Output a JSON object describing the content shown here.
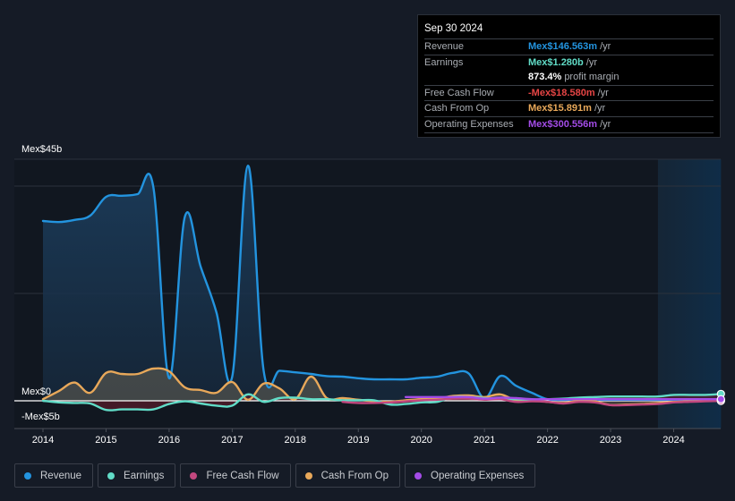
{
  "tooltip": {
    "date": "Sep 30 2024",
    "rows": [
      {
        "label": "Revenue",
        "value": "Mex$146.563m",
        "unit": "/yr",
        "color": "#2394df"
      },
      {
        "label": "Earnings",
        "value": "Mex$1.280b",
        "unit": "/yr",
        "color": "#61dcc7"
      },
      {
        "label": "",
        "value": "873.4%",
        "unit": "profit margin",
        "color": "#ffffff"
      },
      {
        "label": "Free Cash Flow",
        "value": "-Mex$18.580m",
        "unit": "/yr",
        "color": "#e64545"
      },
      {
        "label": "Cash From Op",
        "value": "Mex$15.891m",
        "unit": "/yr",
        "color": "#e8a85a"
      },
      {
        "label": "Operating Expenses",
        "value": "Mex$300.556m",
        "unit": "/yr",
        "color": "#a44ce8"
      }
    ]
  },
  "legend": [
    {
      "label": "Revenue",
      "color": "#2394df"
    },
    {
      "label": "Earnings",
      "color": "#61dcc7"
    },
    {
      "label": "Free Cash Flow",
      "color": "#c2487f"
    },
    {
      "label": "Cash From Op",
      "color": "#e8a85a"
    },
    {
      "label": "Operating Expenses",
      "color": "#a44ce8"
    }
  ],
  "chart_data": {
    "type": "line",
    "title": "",
    "xlabel": "",
    "ylabel": "",
    "y_unit": "Mex$ billions",
    "ylim": [
      -5,
      45
    ],
    "xlim": [
      2013.55,
      2024.75
    ],
    "y_tick_labels": [
      {
        "value": 45,
        "label": "Mex$45b"
      },
      {
        "value": 0,
        "label": "Mex$0"
      },
      {
        "value": -5,
        "label": "-Mex$5b"
      }
    ],
    "gridlines": [
      45,
      40,
      20
    ],
    "x_ticks": [
      2014,
      2015,
      2016,
      2017,
      2018,
      2019,
      2020,
      2021,
      2022,
      2023,
      2024
    ],
    "x_tick_labels": [
      "2014",
      "2015",
      "2016",
      "2017",
      "2018",
      "2019",
      "2020",
      "2021",
      "2022",
      "2023",
      "2024"
    ],
    "highlight_region": [
      2023.75,
      2024.75
    ],
    "series": [
      {
        "name": "Revenue",
        "color": "#2394df",
        "area": true,
        "x": [
          2014.0,
          2014.25,
          2014.5,
          2014.75,
          2015.0,
          2015.25,
          2015.5,
          2015.75,
          2016.0,
          2016.25,
          2016.5,
          2016.75,
          2017.0,
          2017.25,
          2017.5,
          2017.75,
          2018.0,
          2018.25,
          2018.5,
          2018.75,
          2019.0,
          2019.25,
          2019.5,
          2019.75,
          2020.0,
          2020.25,
          2020.5,
          2020.75,
          2021.0,
          2021.25,
          2021.5,
          2021.75,
          2022.0,
          2022.25,
          2022.5,
          2022.75,
          2023.0,
          2023.25,
          2023.5,
          2023.75,
          2024.0,
          2024.25,
          2024.5,
          2024.75
        ],
        "values": [
          33.5,
          33.3,
          33.7,
          34.5,
          38.0,
          38.2,
          38.5,
          39.8,
          4.2,
          34.3,
          25.0,
          16.5,
          4.5,
          43.8,
          5.5,
          5.6,
          5.3,
          5.0,
          4.6,
          4.5,
          4.2,
          4.0,
          4.0,
          4.0,
          4.3,
          4.5,
          5.2,
          5.1,
          0.5,
          4.6,
          2.8,
          1.5,
          0.3,
          0.2,
          0.2,
          0.2,
          0.2,
          0.2,
          0.2,
          0.2,
          0.2,
          0.15,
          0.15,
          0.15
        ]
      },
      {
        "name": "Earnings",
        "color": "#61dcc7",
        "area": true,
        "x": [
          2014.0,
          2014.25,
          2014.5,
          2014.75,
          2015.0,
          2015.25,
          2015.5,
          2015.75,
          2016.0,
          2016.25,
          2016.5,
          2016.75,
          2017.0,
          2017.25,
          2017.5,
          2017.75,
          2018.0,
          2018.25,
          2018.5,
          2018.75,
          2019.0,
          2019.25,
          2019.5,
          2019.75,
          2020.0,
          2020.25,
          2020.5,
          2020.75,
          2021.0,
          2021.25,
          2021.5,
          2021.75,
          2022.0,
          2022.25,
          2022.5,
          2022.75,
          2023.0,
          2023.25,
          2023.5,
          2023.75,
          2024.0,
          2024.25,
          2024.5,
          2024.75
        ],
        "values": [
          0.0,
          -0.3,
          -0.4,
          -0.5,
          -1.7,
          -1.6,
          -1.6,
          -1.6,
          -0.6,
          -0.1,
          -0.5,
          -0.9,
          -0.9,
          1.2,
          -0.2,
          0.5,
          0.6,
          0.3,
          0.3,
          0.1,
          0.1,
          0.1,
          -0.7,
          -0.6,
          -0.3,
          -0.2,
          0.7,
          0.7,
          0.5,
          0.3,
          0.3,
          0.2,
          0.3,
          0.4,
          0.6,
          0.7,
          0.8,
          0.8,
          0.8,
          0.8,
          1.1,
          1.1,
          1.1,
          1.28
        ]
      },
      {
        "name": "Free Cash Flow",
        "color": "#c2487f",
        "area": false,
        "x": [
          2018.75,
          2019.0,
          2019.25,
          2019.5,
          2019.75,
          2020.0,
          2020.25,
          2020.5,
          2020.75,
          2021.0,
          2021.25,
          2021.5,
          2021.75,
          2022.0,
          2022.25,
          2022.5,
          2022.75,
          2023.0,
          2023.25,
          2023.5,
          2023.75,
          2024.0,
          2024.25,
          2024.5,
          2024.75
        ],
        "values": [
          -0.2,
          -0.4,
          -0.4,
          -0.3,
          -0.1,
          0.1,
          0.2,
          0.4,
          0.4,
          0.2,
          0.3,
          -0.2,
          -0.1,
          -0.2,
          -0.5,
          -0.2,
          -0.3,
          -0.8,
          -0.8,
          -0.7,
          -0.6,
          -0.3,
          -0.2,
          -0.1,
          -0.02
        ]
      },
      {
        "name": "Cash From Op",
        "color": "#e8a85a",
        "area": true,
        "x": [
          2014.0,
          2014.25,
          2014.5,
          2014.75,
          2015.0,
          2015.25,
          2015.5,
          2015.75,
          2016.0,
          2016.25,
          2016.5,
          2016.75,
          2017.0,
          2017.25,
          2017.5,
          2017.75,
          2018.0,
          2018.25,
          2018.5,
          2018.75,
          2019.0,
          2019.25,
          2019.5,
          2019.75,
          2020.0,
          2020.25,
          2020.5,
          2020.75,
          2021.0,
          2021.25,
          2021.5,
          2021.75,
          2022.0,
          2022.25,
          2022.5,
          2022.75,
          2023.0,
          2023.25,
          2023.5,
          2023.75,
          2024.0,
          2024.25,
          2024.5,
          2024.75
        ],
        "values": [
          0.3,
          1.8,
          3.4,
          1.5,
          5.2,
          5.0,
          5.0,
          6.0,
          5.5,
          2.5,
          2.0,
          1.5,
          3.5,
          0.2,
          3.2,
          2.3,
          0.3,
          4.5,
          0.5,
          0.5,
          0.2,
          -0.1,
          -0.2,
          0.1,
          0.3,
          0.4,
          0.9,
          1.0,
          0.7,
          1.2,
          0.1,
          0.1,
          -0.2,
          -0.4,
          0.0,
          -0.1,
          -0.8,
          -0.7,
          -0.6,
          -0.4,
          -0.2,
          -0.1,
          0.0,
          0.02
        ]
      },
      {
        "name": "Operating Expenses",
        "color": "#a44ce8",
        "area": false,
        "x": [
          2019.75,
          2020.0,
          2020.25,
          2020.5,
          2020.75,
          2021.0,
          2021.25,
          2021.5,
          2021.75,
          2022.0,
          2022.25,
          2022.5,
          2022.75,
          2023.0,
          2023.25,
          2023.5,
          2023.75,
          2024.0,
          2024.25,
          2024.5,
          2024.75
        ],
        "values": [
          0.7,
          0.7,
          0.7,
          0.7,
          0.7,
          0.4,
          0.6,
          0.5,
          0.3,
          0.3,
          0.3,
          0.3,
          0.3,
          0.3,
          0.3,
          0.3,
          0.3,
          0.3,
          0.3,
          0.3,
          0.3
        ]
      }
    ]
  }
}
